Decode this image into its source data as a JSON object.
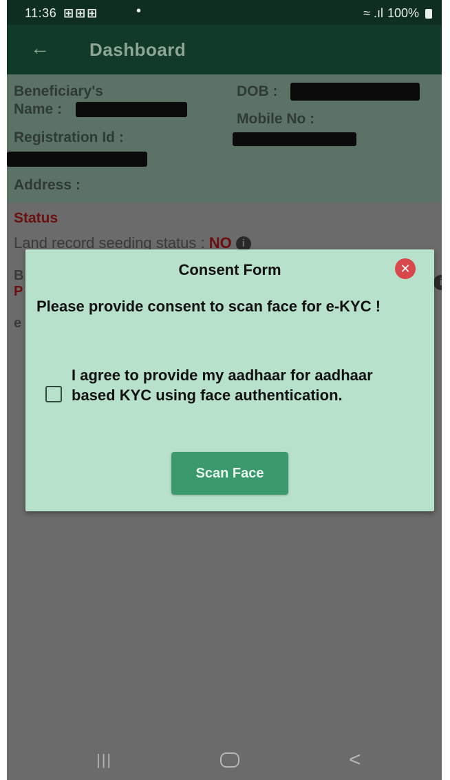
{
  "status_bar": {
    "time": "11:36",
    "notification_icons": "⊞⊞⊞",
    "dot": "•",
    "signal": "≈ .ıl",
    "battery": "100%"
  },
  "app_bar": {
    "back_glyph": "←",
    "title": "Dashboard"
  },
  "beneficiary": {
    "name_label_line1": "Beneficiary's",
    "name_label_line2": "Name :",
    "dob_label": "DOB :",
    "mobile_label": "Mobile No :",
    "registration_label": "Registration Id :",
    "address_label": "Address :"
  },
  "status_section": {
    "title": "Status",
    "land_label": "Land record seeding status :",
    "land_value": "NO",
    "info_glyph": "i",
    "partial_b": "B",
    "partial_p": "P",
    "partial_e": "e"
  },
  "consent_modal": {
    "title": "Consent Form",
    "close_glyph": "✕",
    "message": "Please provide consent to scan face for e-KYC !",
    "agree_text": "I agree to provide my aadhaar for aadhaar based KYC using face authentication.",
    "checkbox_checked": false,
    "scan_button": "Scan Face"
  },
  "nav_bar": {
    "recent_glyph": "|||",
    "back_glyph": "<"
  },
  "colors": {
    "header_dark": "#123a29",
    "status_bar": "#0f2e22",
    "modal_bg": "#b7e1ca",
    "scan_button": "#3a9a6d",
    "close_button": "#d8474a",
    "status_red": "#6a1010",
    "overlay": "#6b6b6b"
  }
}
